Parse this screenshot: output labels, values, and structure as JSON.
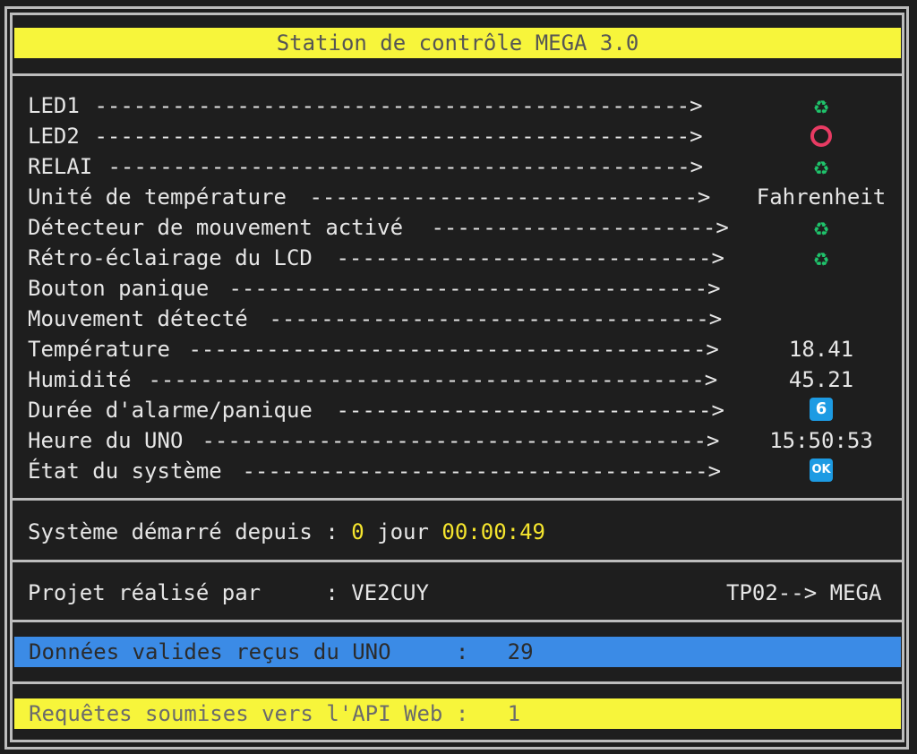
{
  "title": "Station de contrôle MEGA 3.0",
  "rows": [
    {
      "label": "LED1",
      "dashes": " ---------------------------------------------->",
      "value": "",
      "icon": "recycle-icon"
    },
    {
      "label": "LED2",
      "dashes": " ---------------------------------------------->",
      "value": "",
      "icon": "red-circle-icon"
    },
    {
      "label": "RELAI",
      "dashes": " --------------------------------------------->",
      "value": "",
      "icon": "recycle-icon"
    },
    {
      "label": "Unité de température",
      "dashes": " ------------------------------>",
      "value": "Fahrenheit",
      "icon": ""
    },
    {
      "label": "Détecteur de mouvement activé",
      "dashes": " ---------------------->",
      "value": "",
      "icon": "recycle-icon"
    },
    {
      "label": "Rétro-éclairage du LCD",
      "dashes": " ----------------------------->",
      "value": "",
      "icon": "recycle-icon"
    },
    {
      "label": "Bouton panique",
      "dashes": " ------------------------------------->",
      "value": "",
      "icon": ""
    },
    {
      "label": "Mouvement détecté",
      "dashes": " ---------------------------------->",
      "value": "",
      "icon": ""
    },
    {
      "label": "Température",
      "dashes": " ---------------------------------------->",
      "value": "18.41",
      "icon": ""
    },
    {
      "label": "Humidité",
      "dashes": " ------------------------------------------->",
      "value": "45.21",
      "icon": ""
    },
    {
      "label": "Durée d'alarme/panique",
      "dashes": " ----------------------------->",
      "value": "6",
      "icon": "badge-six-icon"
    },
    {
      "label": "Heure du UNO",
      "dashes": " --------------------------------------->",
      "value": "15:50:53",
      "icon": ""
    },
    {
      "label": "État du système",
      "dashes": " ------------------------------------>",
      "value": "OK",
      "icon": "badge-ok-icon"
    }
  ],
  "uptime": {
    "label": "Système démarré depuis : ",
    "days": "0",
    "day_word": " jour ",
    "time": "00:00:49"
  },
  "credits": {
    "label": "Projet réalisé par     : VE2CUY",
    "right": "TP02--> MEGA"
  },
  "uno_data": "Données valides reçus du UNO     :   29",
  "api_requests": "Requêtes soumises vers l'API Web :   1",
  "colors": {
    "title_bar": "#f7f53b",
    "blue_bar": "#3b8be6",
    "highlight": "#f5e52e",
    "recycle": "#1fc36b",
    "circle": "#e83b63",
    "badge": "#1d9be3"
  }
}
